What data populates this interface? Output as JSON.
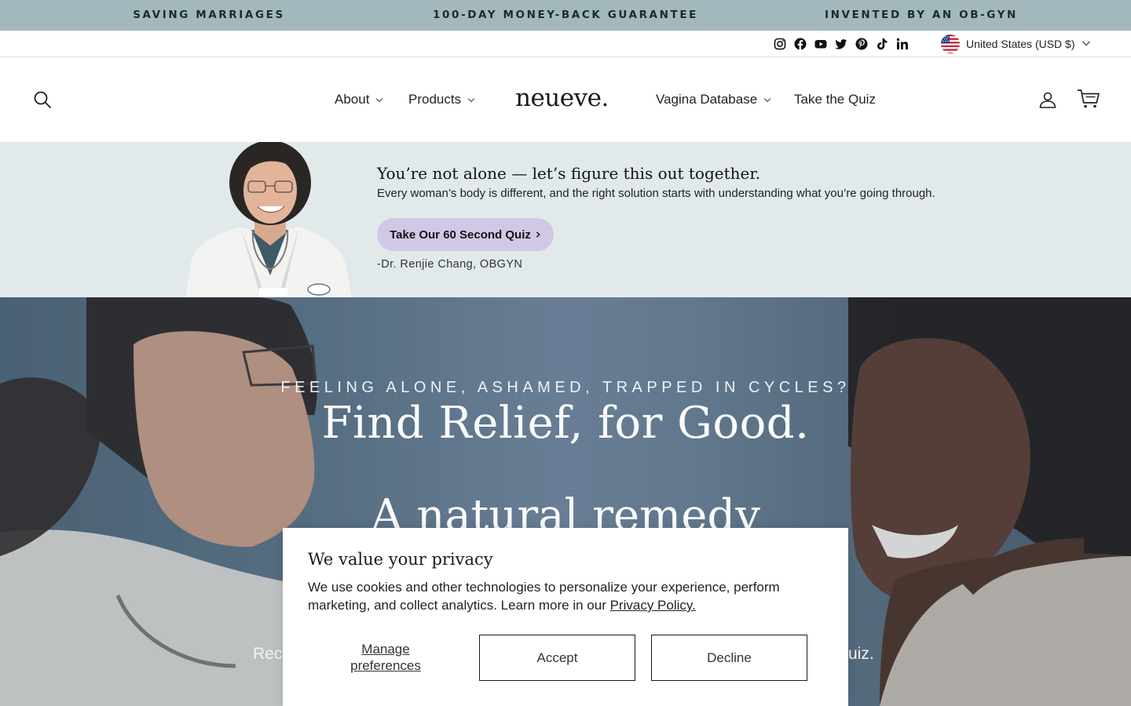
{
  "announcement": {
    "items": [
      "SAVING MARRIAGES",
      "100-DAY MONEY-BACK GUARANTEE",
      "INVENTED BY AN OB-GYN"
    ]
  },
  "utility": {
    "social_icons": [
      "instagram-icon",
      "facebook-icon",
      "youtube-icon",
      "twitter-icon",
      "pinterest-icon",
      "tiktok-icon",
      "linkedin-icon"
    ],
    "currency_label": "United States (USD $)"
  },
  "header": {
    "logo_text": "neueve.",
    "nav": [
      {
        "label": "About",
        "has_dropdown": true
      },
      {
        "label": "Products",
        "has_dropdown": true
      },
      {
        "label": "Vagina Database",
        "has_dropdown": true
      },
      {
        "label": "Take the Quiz",
        "has_dropdown": false
      }
    ]
  },
  "promo": {
    "title": "You’re not alone — let’s figure this out together.",
    "text": "Every woman’s body is different, and the right solution starts with understanding what you’re going through.",
    "button_label": "Take Our 60 Second Quiz",
    "signature": "-Dr. Renjie Chang, OBGYN",
    "background_color": "#e1e9eb",
    "button_color": "#d1c8e6"
  },
  "hero": {
    "eyebrow": "FEELING ALONE, ASHAMED, TRAPPED IN CYCLES?",
    "title": "Find Relief, for Good.",
    "subtitle": "A natural remedy",
    "line_left": "Rec",
    "line_right": "uiz."
  },
  "cookie": {
    "title": "We value your privacy",
    "text": "We use cookies and other technologies to personalize your experience, perform marketing, and collect analytics. Learn more in our",
    "link": "Privacy Policy.",
    "manage_label": "Manage preferences",
    "accept_label": "Accept",
    "decline_label": "Decline"
  },
  "colors": {
    "announcement_bg": "#a3b8bd",
    "hero_bg": "#5d7589"
  }
}
